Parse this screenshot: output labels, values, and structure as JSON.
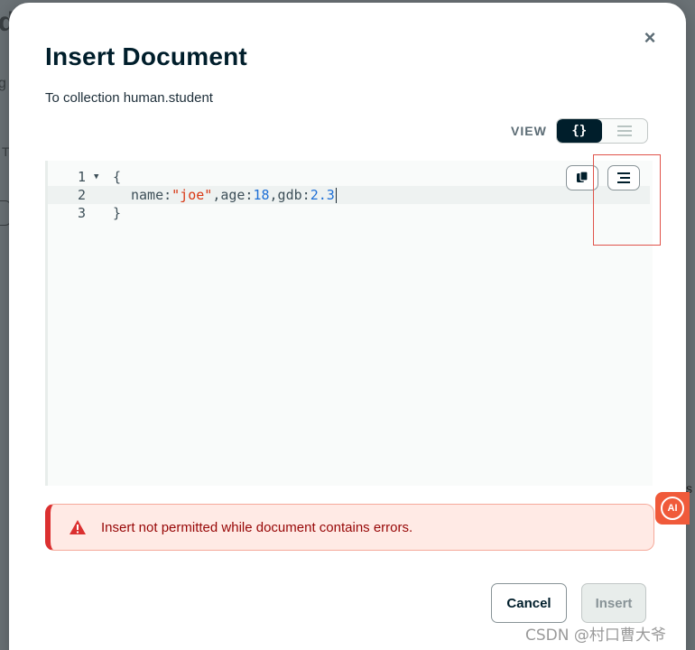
{
  "background": {
    "heading_fragment": "d",
    "text_fragment_1": "g",
    "text_fragment_2": "T",
    "text_fragment_3": "s"
  },
  "modal": {
    "title": "Insert Document",
    "subtitle": "To collection human.student",
    "close_glyph": "×",
    "view_label": "VIEW",
    "view_toggle": {
      "active": "json",
      "json_glyph": "{}",
      "list_icon": "list-icon"
    },
    "editor": {
      "lines": [
        {
          "num": "1",
          "text": "{"
        },
        {
          "num": "2",
          "key_name": "name:",
          "str_val": "\"joe\"",
          "sep1": ",age:",
          "num_age": "18",
          "sep2": ",gdb:",
          "num_gdb": "2.3"
        },
        {
          "num": "3",
          "text": "}"
        }
      ],
      "copy_icon": "copy-icon",
      "format_icon": "format-icon"
    },
    "error_message": "Insert not permitted while document contains errors.",
    "cancel_label": "Cancel",
    "insert_label": "Insert"
  },
  "ai_badge_label": "AI",
  "watermark": "CSDN @村口曹大爷",
  "colors": {
    "title": "#001e2b",
    "string_token": "#d83713",
    "number_token": "#1d6fd6",
    "error_border": "#db3030",
    "error_bg": "#ffeae5",
    "ai_badge": "#f05a3a"
  }
}
